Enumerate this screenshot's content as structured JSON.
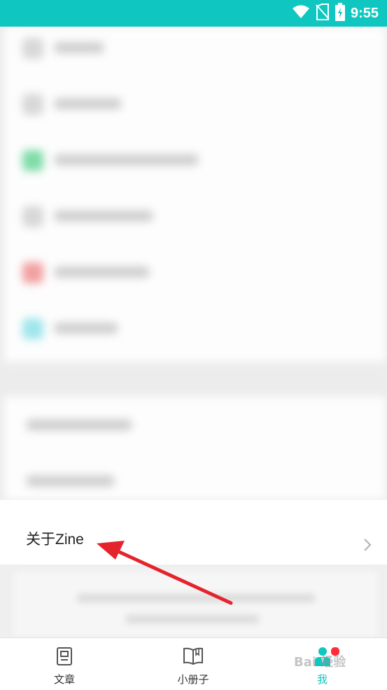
{
  "status_bar": {
    "time": "9:55",
    "wifi_icon": "wifi-icon",
    "sim_icon": "no-sim-icon",
    "battery_icon": "battery-charging-icon"
  },
  "about_row": {
    "label": "关于Zine",
    "chevron_icon": "chevron-right-icon"
  },
  "tabs": [
    {
      "label": "文章",
      "icon": "article-icon",
      "active": false
    },
    {
      "label": "小册子",
      "icon": "book-icon",
      "active": false
    },
    {
      "label": "我",
      "icon": "profile-icon",
      "active": true,
      "badge": true
    }
  ],
  "watermark": "Bai 经验",
  "colors": {
    "accent": "#0fc7c0",
    "badge": "#ff2d3b",
    "annotation_arrow": "#e4232d"
  }
}
